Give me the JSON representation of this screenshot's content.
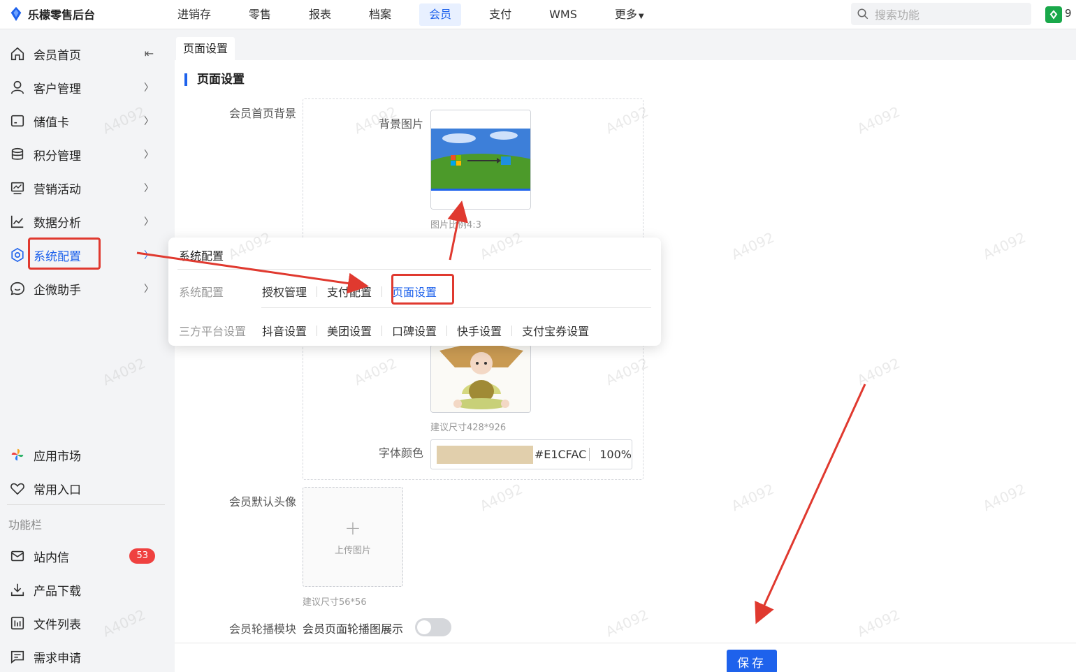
{
  "app": {
    "title": "乐檬零售后台"
  },
  "topnav": {
    "items": [
      {
        "label": "进销存"
      },
      {
        "label": "零售"
      },
      {
        "label": "报表"
      },
      {
        "label": "档案"
      },
      {
        "label": "会员"
      },
      {
        "label": "支付"
      },
      {
        "label": "WMS"
      },
      {
        "label": "更多"
      }
    ],
    "active_index": 4,
    "search_placeholder": "搜索功能",
    "right_text": "9"
  },
  "sidebar": {
    "items": [
      {
        "label": "会员首页",
        "icon": "home-icon"
      },
      {
        "label": "客户管理",
        "icon": "user-icon"
      },
      {
        "label": "储值卡",
        "icon": "card-icon"
      },
      {
        "label": "积分管理",
        "icon": "coins-icon"
      },
      {
        "label": "营销活动",
        "icon": "monitor-icon"
      },
      {
        "label": "数据分析",
        "icon": "chart-icon"
      },
      {
        "label": "系统配置",
        "icon": "settings-icon"
      },
      {
        "label": "企微助手",
        "icon": "chat-icon"
      }
    ],
    "bottom_items": [
      {
        "label": "应用市场",
        "icon": "pinwheel-icon"
      },
      {
        "label": "常用入口",
        "icon": "heart-icon"
      }
    ],
    "section_label": "功能栏",
    "function_items": [
      {
        "label": "站内信",
        "icon": "mail-icon",
        "badge": "53"
      },
      {
        "label": "产品下载",
        "icon": "download-icon"
      },
      {
        "label": "文件列表",
        "icon": "list-icon"
      },
      {
        "label": "需求申请",
        "icon": "request-icon"
      }
    ]
  },
  "main": {
    "tab_label": "页面设置",
    "section_title": "页面设置",
    "form": {
      "home_bg_label": "会员首页背景",
      "bg_image_label": "背景图片",
      "bg_image_hint": "图片比例4:3",
      "card_hint": "建议尺寸428*926",
      "font_color_label": "字体颜色",
      "font_color_hex": "#E1CFAC",
      "font_color_value": "#E1CFAC",
      "font_color_opacity": "100%",
      "avatar_label": "会员默认头像",
      "upload_plus": "+",
      "upload_text": "上传图片",
      "avatar_hint": "建议尺寸56*56",
      "carousel_label": "会员轮播模块",
      "carousel_text": "会员页面轮播图展示",
      "carousel_enabled": false
    },
    "save_label": "保存"
  },
  "popover": {
    "title": "系统配置",
    "rows": [
      {
        "label": "系统配置",
        "links": [
          "授权管理",
          "支付配置",
          "页面设置"
        ],
        "active": "页面设置"
      },
      {
        "label": "三方平台设置",
        "links": [
          "抖音设置",
          "美团设置",
          "口碑设置",
          "快手设置",
          "支付宝券设置"
        ]
      }
    ]
  },
  "watermark": "A4092",
  "colors": {
    "accent": "#1e62ec",
    "annotation": "#e0392f",
    "badge": "#ef4140"
  }
}
